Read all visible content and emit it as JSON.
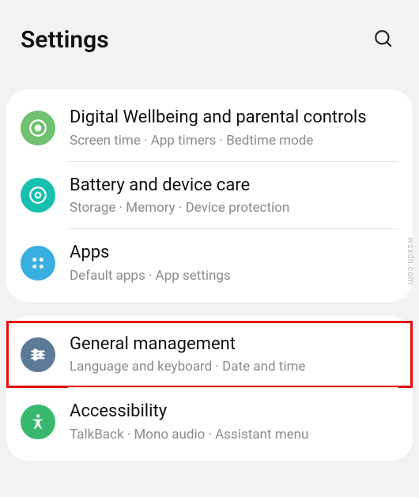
{
  "header": {
    "title": "Settings"
  },
  "groups": [
    {
      "items": [
        {
          "key": "wellbeing",
          "title": "Digital Wellbeing and parental controls",
          "subtitle": "Screen time  ·  App timers  ·  Bedtime mode"
        },
        {
          "key": "battery",
          "title": "Battery and device care",
          "subtitle": "Storage  ·  Memory  ·  Device protection"
        },
        {
          "key": "apps",
          "title": "Apps",
          "subtitle": "Default apps  ·  App settings"
        }
      ]
    },
    {
      "items": [
        {
          "key": "general",
          "title": "General management",
          "subtitle": "Language and keyboard  ·  Date and time",
          "highlighted": true
        },
        {
          "key": "access",
          "title": "Accessibility",
          "subtitle": "TalkBack  ·  Mono audio  ·  Assistant menu"
        }
      ]
    }
  ],
  "watermark": "wsxdn.com"
}
